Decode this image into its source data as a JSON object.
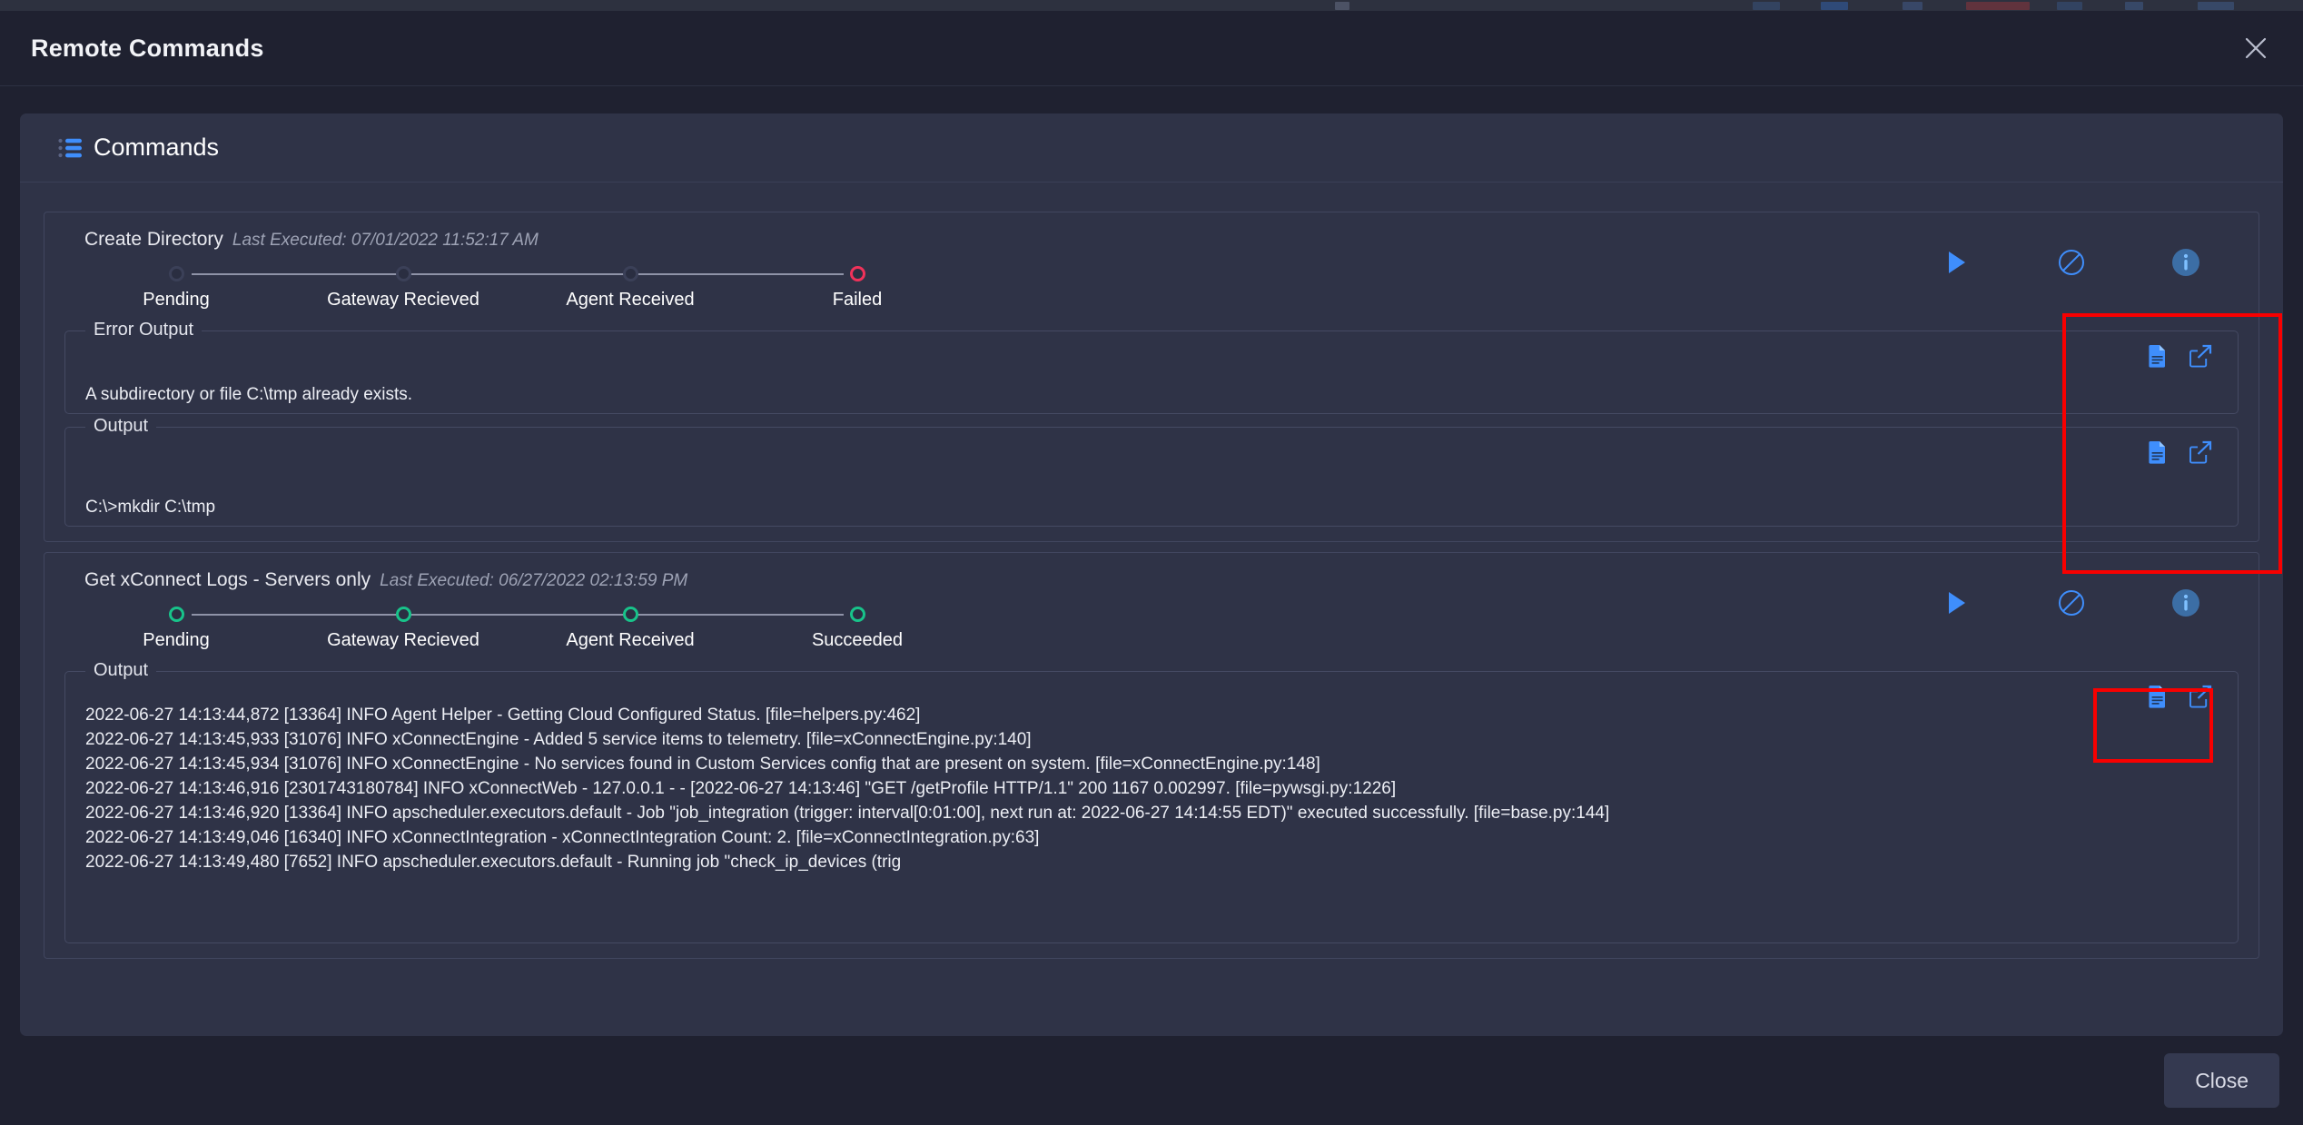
{
  "window": {
    "title": "Remote Commands",
    "close_icon": "close-x-icon"
  },
  "panel": {
    "title": "Commands",
    "icon": "list-bullets-icon"
  },
  "colors": {
    "accent_blue": "#3f8efc",
    "status_failed": "#f0325a",
    "status_success": "#18c38a",
    "annotation_red": "#f80000",
    "panel_bg": "#2f3347",
    "modal_bg": "#1f2130"
  },
  "commands": [
    {
      "name": "Create Directory",
      "last_executed": "Last Executed: 07/01/2022 11:52:17 AM",
      "steps": [
        {
          "label": "Pending",
          "state": "dim"
        },
        {
          "label": "Gateway Recieved",
          "state": "dim"
        },
        {
          "label": "Agent Received",
          "state": "dim"
        },
        {
          "label": "Failed",
          "state": "red"
        }
      ],
      "actions": [
        {
          "name": "run-command-button",
          "icon": "play-icon"
        },
        {
          "name": "cancel-command-button",
          "icon": "no-entry-icon"
        },
        {
          "name": "command-info-button",
          "icon": "info-circle-icon"
        }
      ],
      "outputs": [
        {
          "legend": "Error Output",
          "lines": [
            "A subdirectory or file C:\\tmp already exists."
          ],
          "tools": [
            {
              "name": "copy-output-button",
              "icon": "document-copy-icon"
            },
            {
              "name": "open-output-button",
              "icon": "external-link-icon"
            }
          ]
        },
        {
          "legend": "Output",
          "lines": [
            "C:\\>mkdir C:\\tmp"
          ],
          "tools": [
            {
              "name": "copy-output-button",
              "icon": "document-copy-icon"
            },
            {
              "name": "open-output-button",
              "icon": "external-link-icon"
            }
          ]
        }
      ]
    },
    {
      "name": "Get xConnect Logs - Servers only",
      "last_executed": "Last Executed: 06/27/2022 02:13:59 PM",
      "steps": [
        {
          "label": "Pending",
          "state": "green"
        },
        {
          "label": "Gateway Recieved",
          "state": "green"
        },
        {
          "label": "Agent Received",
          "state": "green"
        },
        {
          "label": "Succeeded",
          "state": "green"
        }
      ],
      "actions": [
        {
          "name": "run-command-button",
          "icon": "play-icon"
        },
        {
          "name": "cancel-command-button",
          "icon": "no-entry-icon"
        },
        {
          "name": "command-info-button",
          "icon": "info-circle-icon"
        }
      ],
      "outputs": [
        {
          "legend": "Output",
          "lines": [
            "2022-06-27 14:13:44,872 [13364] INFO Agent Helper - Getting Cloud Configured Status. [file=helpers.py:462]",
            "2022-06-27 14:13:45,933 [31076] INFO xConnectEngine - Added 5 service items to telemetry. [file=xConnectEngine.py:140]",
            "2022-06-27 14:13:45,934 [31076] INFO xConnectEngine - No services found in Custom Services config that are present on system. [file=xConnectEngine.py:148]",
            "2022-06-27 14:13:46,916 [2301743180784] INFO xConnectWeb - 127.0.0.1 - - [2022-06-27 14:13:46] \"GET /getProfile HTTP/1.1\" 200 1167 0.002997. [file=pywsgi.py:1226]",
            "2022-06-27 14:13:46,920 [13364] INFO apscheduler.executors.default - Job \"job_integration (trigger: interval[0:01:00], next run at: 2022-06-27 14:14:55 EDT)\" executed successfully. [file=base.py:144]",
            "2022-06-27 14:13:49,046 [16340] INFO xConnectIntegration - xConnectIntegration Count: 2. [file=xConnectIntegration.py:63]",
            "2022-06-27 14:13:49,480 [7652] INFO apscheduler.executors.default - Running job \"check_ip_devices (trig"
          ],
          "tools": [
            {
              "name": "copy-output-button",
              "icon": "document-copy-icon"
            },
            {
              "name": "open-output-button",
              "icon": "external-link-icon"
            }
          ]
        }
      ]
    }
  ],
  "footer": {
    "close_label": "Close"
  }
}
